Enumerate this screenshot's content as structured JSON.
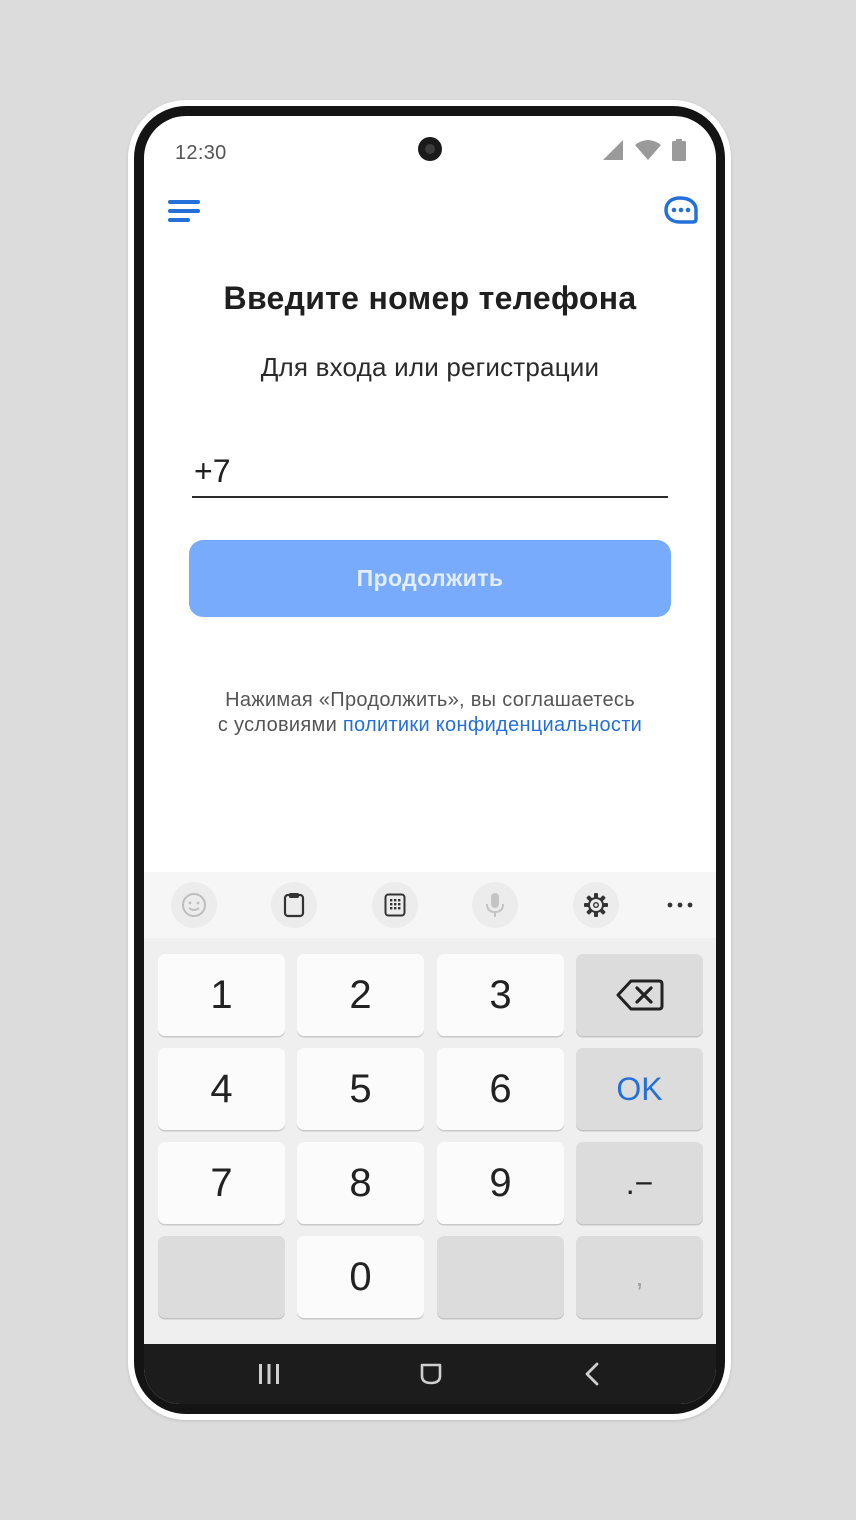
{
  "status_bar": {
    "time": "12:30"
  },
  "header": {
    "menu_icon": "hamburger-menu-icon",
    "support_icon": "chat-bubble-icon"
  },
  "main": {
    "title": "Введите номер телефона",
    "subtitle": "Для входа или регистрации",
    "phone_value": "+7",
    "continue_label": "Продолжить",
    "terms_text": "Нажимая «Продолжить», вы соглашаетесь",
    "terms_prefix": "с условиями ",
    "terms_link": "политики конфиденциальности"
  },
  "keyboard": {
    "toolbar": [
      "emoji-icon",
      "clipboard-icon",
      "keypad-icon",
      "microphone-icon",
      "gear-icon",
      "more-icon"
    ],
    "keys": [
      "1",
      "2",
      "3",
      "4",
      "5",
      "6",
      "7",
      "8",
      "9",
      "0"
    ],
    "ok_label": "OK",
    "punct_label": ".−",
    "comma_label": ","
  },
  "colors": {
    "accent": "#2470d8",
    "button_disabled": "#79abfc",
    "background": "#dcdcdc"
  }
}
